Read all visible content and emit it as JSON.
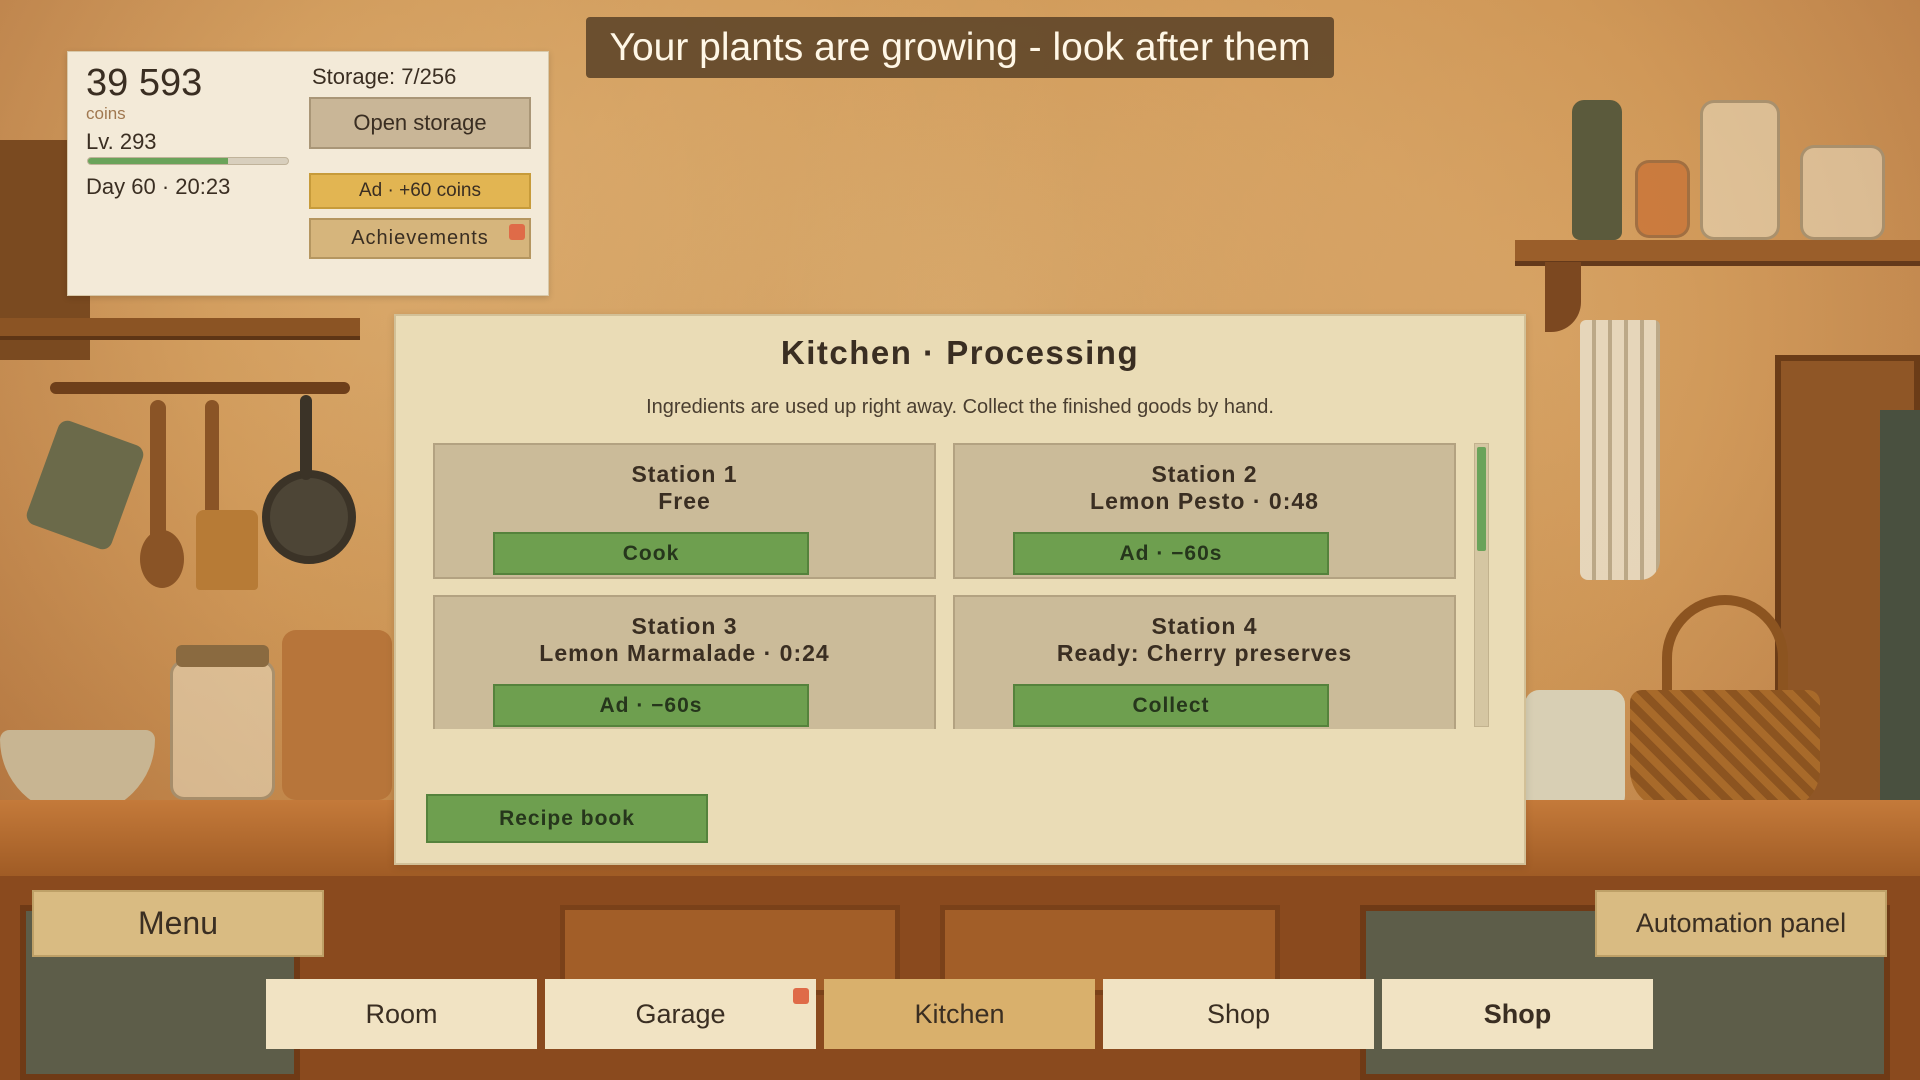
{
  "banner": {
    "text": "Your plants are growing - look after them"
  },
  "stats": {
    "coins": "39 593",
    "coins_label": "coins",
    "level": "Lv. 293",
    "xp_progress": 0.7,
    "day_time": "Day 60 · 20:23",
    "storage": "Storage: 7/256",
    "open_storage_label": "Open storage",
    "ad_coins_label": "Ad · +60 coins",
    "achievements_label": "Achievements",
    "achievements_has_notification": true
  },
  "kitchen": {
    "title": "Kitchen · Processing",
    "subtitle": "Ingredients are used up right away. Collect the finished goods by hand.",
    "stations": [
      {
        "name": "Station 1",
        "status": "Free",
        "button": "Cook"
      },
      {
        "name": "Station 2",
        "status": "Lemon Pesto · 0:48",
        "button": "Ad · −60s"
      },
      {
        "name": "Station 3",
        "status": "Lemon Marmalade · 0:24",
        "button": "Ad · −60s"
      },
      {
        "name": "Station 4",
        "status": "Ready: Cherry preserves",
        "button": "Collect"
      }
    ],
    "recipe_book_label": "Recipe book"
  },
  "controls": {
    "menu_label": "Menu",
    "automation_label": "Automation panel"
  },
  "tabs": [
    {
      "label": "Room",
      "active": false,
      "notification": false
    },
    {
      "label": "Garage",
      "active": false,
      "notification": true
    },
    {
      "label": "Kitchen",
      "active": true,
      "notification": false
    },
    {
      "label": "Shop",
      "active": false,
      "notification": false
    },
    {
      "label": "Shop",
      "active": false,
      "notification": false,
      "bold": true
    }
  ],
  "colors": {
    "accent_green": "#6e9f4f",
    "notification": "#df6b48",
    "active_tab": "#d9b06c",
    "ad_button": "#e2b552"
  }
}
